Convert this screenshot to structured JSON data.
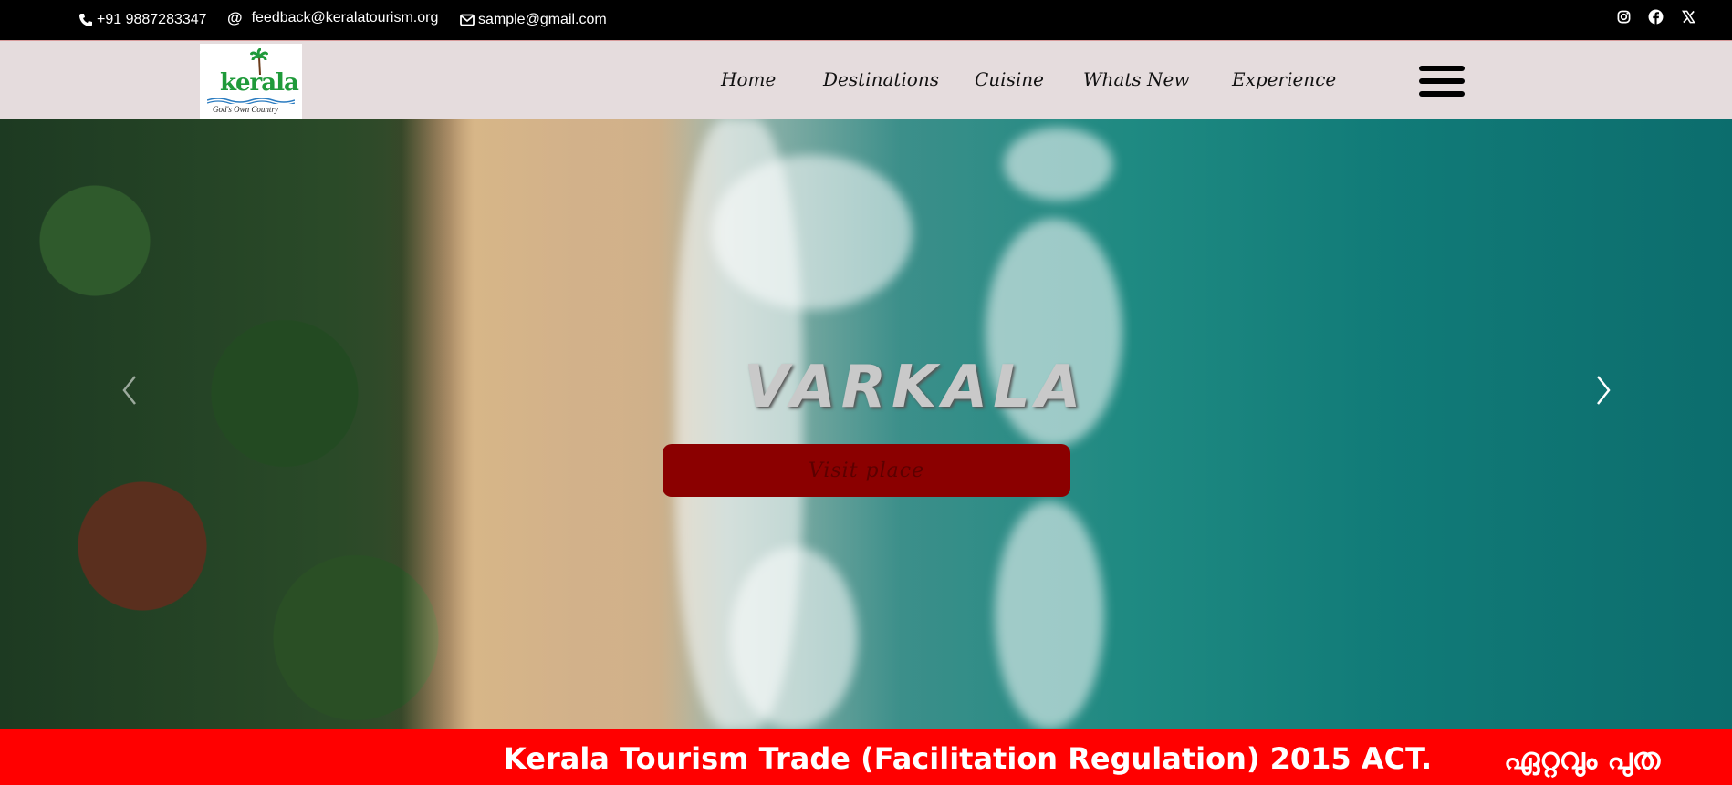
{
  "topbar": {
    "phone": "+91 9887283347",
    "feedback_email": "feedback@keralatourism.org",
    "sample_email": "sample@gmail.com",
    "social_icons": [
      "instagram-icon",
      "facebook-icon",
      "x-icon"
    ]
  },
  "logo": {
    "text": "kerala",
    "tagline": "God's Own Country"
  },
  "nav": {
    "items": [
      {
        "label": "Home"
      },
      {
        "label": "Destinations"
      },
      {
        "label": "Cuisine"
      },
      {
        "label": "Whats New"
      },
      {
        "label": "Experience"
      }
    ]
  },
  "hero": {
    "slide_title": "VARKALA",
    "button_label": "Visit   place"
  },
  "marquee": {
    "text": "Kerala Tourism Trade (Facilitation Regulation) 2015 ACT.",
    "text2": "ഏറ്റവും പുത"
  },
  "colors": {
    "topbar_bg": "#000000",
    "header_bg": "#e5dcdd",
    "button_bg": "#8b0000",
    "marquee_bg": "#ff0000"
  }
}
